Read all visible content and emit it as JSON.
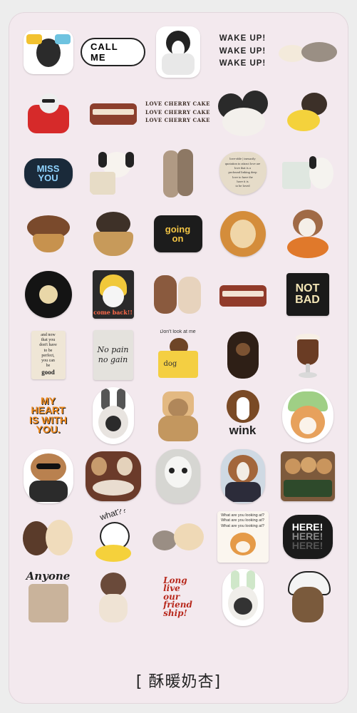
{
  "caption": "[ 酥暖奶杏]",
  "stickers": {
    "call_me": "CALL ME",
    "wake_up": [
      "WAKE UP!",
      "WAKE UP!",
      "WAKE UP!"
    ],
    "love_cherry_cake": [
      "LOVE CHERRY CAKE",
      "LOVE CHERRY CAKE",
      "LOVE CHERRY CAKE"
    ],
    "miss_you": [
      "MISS",
      "YOU"
    ],
    "heart_text": [
      "love-able | inexactly",
      "quotation to attract love are",
      "love that is a",
      "profound linking deep",
      "love to have the",
      "have it is",
      "to be loved"
    ],
    "going_on": [
      "going",
      "on"
    ],
    "come_back": "come back!!",
    "not_bad": [
      "NOT",
      "BAD"
    ],
    "quote_card": [
      "and now",
      "that you",
      "don't have",
      "to be",
      "perfect,",
      "you can",
      "be",
      "good"
    ],
    "no_pain": [
      "No pain",
      "no gain"
    ],
    "dont_look": "Don't look at me",
    "dog_box": "dog",
    "my_heart": [
      "MY",
      "HEART",
      "IS WITH",
      "YOU."
    ],
    "wink": "wink",
    "what": "what??",
    "what_are_you": [
      "What are you looking at?",
      "What are you looking at?",
      "What are you looking at?"
    ],
    "here": [
      "HERE!",
      "HERE!",
      "HERE!"
    ],
    "anyone": "Anyone",
    "long_live": [
      "Long",
      "live",
      "our",
      "friend",
      "ship!"
    ]
  }
}
